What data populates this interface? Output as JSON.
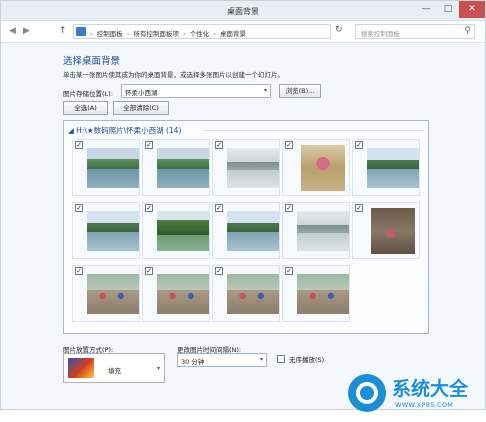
{
  "window": {
    "title": "桌面背景",
    "minimize": "—",
    "maximize": "□",
    "close": "✕"
  },
  "address_bar": {
    "back": "◀",
    "forward": "▶",
    "up": "↑",
    "breadcrumbs": [
      "控制面板",
      "所有控制面板项",
      "个性化",
      "桌面背景"
    ],
    "separator": "›",
    "refresh": "↻",
    "search_placeholder": "搜索控制面板",
    "icons": {
      "location": "control-panel-icon",
      "search": "search-icon"
    }
  },
  "main": {
    "title": "选择桌面背景",
    "subtitle": "单击某一张图片使其成为你的桌面背景，或选择多张图片以创建一个幻灯片。",
    "location_label": "图片存储位置(L):",
    "location_value": "怀柔小西湖",
    "browse_button": "浏览(B)...",
    "select_all_button": "全选(A)",
    "clear_all_button": "全部清除(C)"
  },
  "gallery": {
    "group_label": "◢  H:\\★数码照片\\怀柔小西湖 (14)",
    "thumbnails": [
      {
        "checked": true,
        "scene": "dam-lake"
      },
      {
        "checked": true,
        "scene": "dam-lake"
      },
      {
        "checked": true,
        "scene": "misty-lake"
      },
      {
        "checked": true,
        "scene": "person-flowers"
      },
      {
        "checked": true,
        "scene": "lake-hills"
      },
      {
        "checked": true,
        "scene": "lake-hills"
      },
      {
        "checked": true,
        "scene": "green-valley"
      },
      {
        "checked": true,
        "scene": "lake-hills"
      },
      {
        "checked": true,
        "scene": "misty-lake"
      },
      {
        "checked": true,
        "scene": "rock-portrait"
      },
      {
        "checked": true,
        "scene": "group-photo"
      },
      {
        "checked": true,
        "scene": "group-photo"
      },
      {
        "checked": true,
        "scene": "group-photo"
      },
      {
        "checked": true,
        "scene": "group-photo"
      }
    ],
    "check_mark": "✓"
  },
  "options": {
    "position_label": "图片放置方式(P):",
    "position_value": "填充",
    "interval_label": "更改图片时间间隔(N):",
    "interval_value": "30 分钟",
    "shuffle_label": "无序播放(S)",
    "shuffle_checked": false,
    "dropdown_arrow": "▾"
  },
  "watermark": {
    "title": "系统大全",
    "url": "WWW.XP85.COM"
  },
  "colors": {
    "accent": "#1e4f95",
    "watermark": "#1a8fd6"
  }
}
